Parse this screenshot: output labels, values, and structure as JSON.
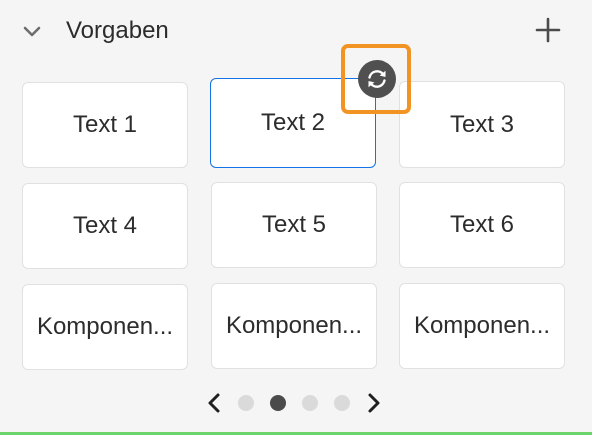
{
  "header": {
    "title": "Vorgaben",
    "collapse_icon": "chevron-down-icon",
    "add_icon": "plus-icon"
  },
  "tiles": [
    {
      "label": "Text 1",
      "selected": false
    },
    {
      "label": "Text 2",
      "selected": true
    },
    {
      "label": "Text 3",
      "selected": false
    },
    {
      "label": "Text 4",
      "selected": false
    },
    {
      "label": "Text 5",
      "selected": false
    },
    {
      "label": "Text 6",
      "selected": false
    },
    {
      "label": "Komponen...",
      "selected": false
    },
    {
      "label": "Komponen...",
      "selected": false
    },
    {
      "label": "Komponen...",
      "selected": false
    }
  ],
  "refresh": {
    "icon": "refresh-icon"
  },
  "pager": {
    "prev_icon": "chevron-left-icon",
    "next_icon": "chevron-right-icon",
    "page_count": 4,
    "current_page": 2
  },
  "colors": {
    "selection_border": "#1473e6",
    "highlight": "#f29423",
    "refresh_button": "#505050",
    "dot_active": "#4b4b4b",
    "dot_inactive": "#dadada",
    "bottom_line": "#6ad36a"
  }
}
